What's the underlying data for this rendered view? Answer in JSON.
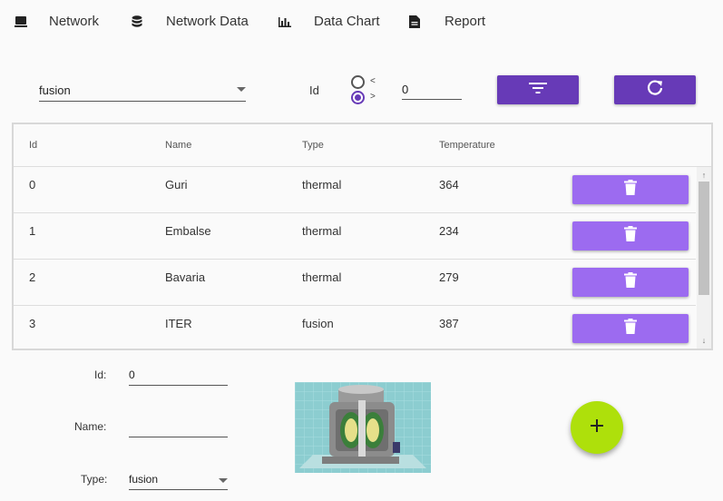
{
  "nav": {
    "items": [
      {
        "label": "Network",
        "icon": "computer-icon"
      },
      {
        "label": "Network Data",
        "icon": "database-icon"
      },
      {
        "label": "Data Chart",
        "icon": "bar-chart-icon"
      },
      {
        "label": "Report",
        "icon": "document-icon"
      }
    ]
  },
  "filter": {
    "type_value": "fusion",
    "id_label": "Id",
    "radio_lt_label": "<",
    "radio_gt_label": ">",
    "radio_selected": ">",
    "id_value": "0",
    "filter_icon": "filter-list-icon",
    "refresh_icon": "refresh-icon"
  },
  "table": {
    "headers": [
      "Id",
      "Name",
      "Type",
      "Temperature"
    ],
    "rows": [
      {
        "id": "0",
        "name": "Guri",
        "type": "thermal",
        "temperature": "364"
      },
      {
        "id": "1",
        "name": "Embalse",
        "type": "thermal",
        "temperature": "234"
      },
      {
        "id": "2",
        "name": "Bavaria",
        "type": "thermal",
        "temperature": "279"
      },
      {
        "id": "3",
        "name": "ITER",
        "type": "fusion",
        "temperature": "387"
      }
    ],
    "delete_icon": "trash-icon"
  },
  "form": {
    "id_label": "Id:",
    "id_value": "0",
    "name_label": "Name:",
    "name_value": "",
    "type_label": "Type:",
    "type_value": "fusion"
  },
  "fab": {
    "icon": "plus-icon",
    "label": "+"
  },
  "colors": {
    "primary": "#673ab7",
    "delete_button": "#9c6bf0",
    "fab": "#aee00b"
  }
}
